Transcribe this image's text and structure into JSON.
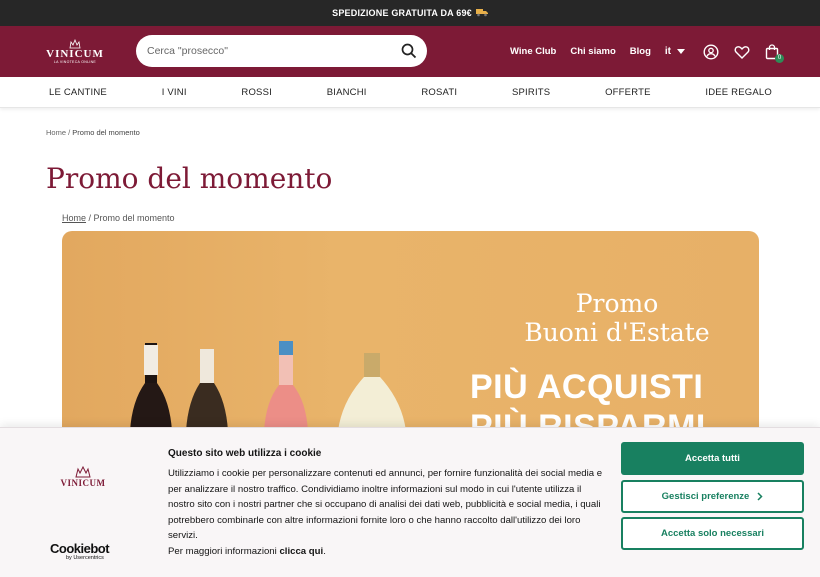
{
  "topbar": {
    "text": "SPEDIZIONE GRATUITA DA 69€",
    "icon": "truck-icon"
  },
  "brand": {
    "name": "VINICUM",
    "sub": "LA VINOTECA ONLINE",
    "color": "#7d1a36"
  },
  "search": {
    "placeholder": "Cerca \"prosecco\""
  },
  "header_nav": {
    "wine_club": "Wine Club",
    "chi_siamo": "Chi siamo",
    "blog": "Blog",
    "lang": "it",
    "cart_count": "0"
  },
  "categories": [
    "LE CANTINE",
    "I VINI",
    "ROSSI",
    "BIANCHI",
    "ROSATI",
    "SPIRITS",
    "OFFERTE",
    "IDEE REGALO"
  ],
  "breadcrumb": {
    "home": "Home",
    "sep": " / ",
    "current": "Promo del momento"
  },
  "page_title": "Promo del momento",
  "banner": {
    "line1": "Promo",
    "line2": "Buoni d'Estate",
    "headline1": "PIÙ ACQUISTI",
    "headline2": "PIÙ RISPARMI"
  },
  "cookie": {
    "title": "Questo sito web utilizza i cookie",
    "text": "Utilizziamo i cookie per personalizzare contenuti ed annunci, per fornire funzionalità dei social media e per analizzare il nostro traffico. Condividiamo inoltre informazioni sul modo in cui l'utente utilizza il nostro sito con i nostri partner che si occupano di analisi dei dati web, pubblicità e social media, i quali potrebbero combinarle con altre informazioni fornite loro o che hanno raccolto dall'utilizzo dei loro servizi.",
    "more_prefix": "Per maggiori informazioni ",
    "more_link": "clicca qui",
    "more_suffix": ".",
    "accept_all": "Accetta tutti",
    "prefs": "Gestisci preferenze",
    "necessary": "Accetta solo necessari",
    "cookiebot": "Cookiebot",
    "cookiebot_sub": "by Usercentrics",
    "accent": "#188060"
  }
}
